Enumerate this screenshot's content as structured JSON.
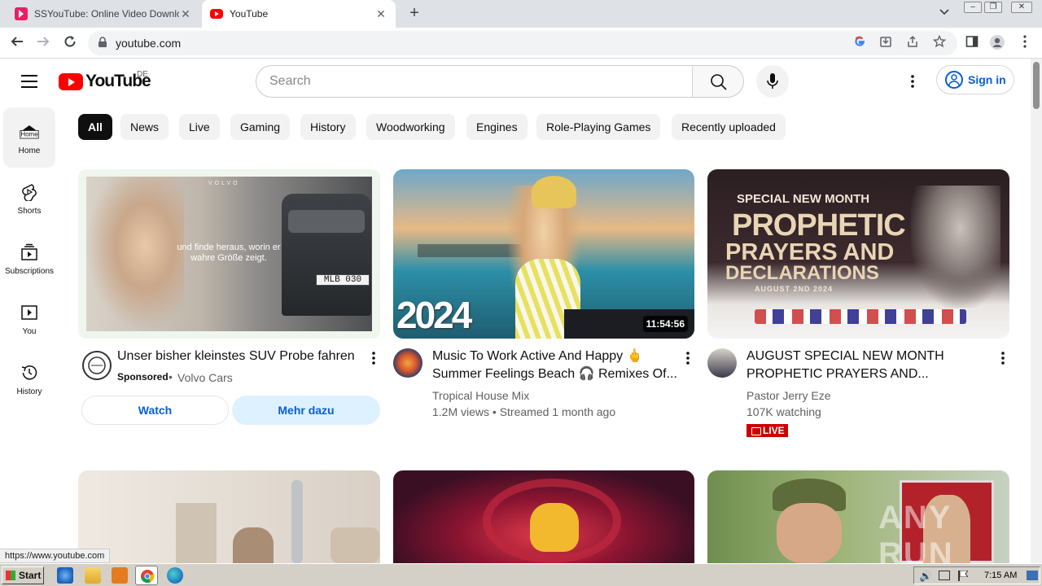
{
  "browser": {
    "tabs": [
      {
        "title": "SSYouTube: Online Video Downloader",
        "active": false
      },
      {
        "title": "YouTube",
        "active": true
      }
    ],
    "url": "youtube.com",
    "status_url": "https://www.youtube.com"
  },
  "masthead": {
    "logo_text": "YouTube",
    "country_code": "DE",
    "search_placeholder": "Search",
    "signin_label": "Sign in"
  },
  "sidebar": {
    "items": [
      {
        "label": "Home",
        "icon": "home-icon",
        "active": true
      },
      {
        "label": "Shorts",
        "icon": "shorts-icon"
      },
      {
        "label": "Subscriptions",
        "icon": "subscriptions-icon"
      },
      {
        "label": "You",
        "icon": "you-icon"
      },
      {
        "label": "History",
        "icon": "history-icon"
      }
    ]
  },
  "chips": [
    "All",
    "News",
    "Live",
    "Gaming",
    "History",
    "Woodworking",
    "Engines",
    "Role-Playing Games",
    "Recently uploaded"
  ],
  "videos": [
    {
      "title": "Unser bisher kleinstes SUV Probe fahren",
      "sponsored_label": "Sponsored",
      "channel": "Volvo Cars",
      "ad_overlay_text": "und finde heraus, worin er wahre Größe zeigt.",
      "plate": "MLB 030",
      "brand_mark": "VOLVO",
      "watch_label": "Watch",
      "more_label": "Mehr dazu"
    },
    {
      "title_line1": "Music To Work Active And Happy 🖕",
      "title_line2": "Summer Feelings Beach 🎧 Remixes Of...",
      "channel": "Tropical House Mix",
      "stats": "1.2M views • Streamed 1 month ago",
      "duration": "11:54:56",
      "thumb_text": "2024"
    },
    {
      "title_line1": "AUGUST SPECIAL NEW MONTH",
      "title_line2": "PROPHETIC PRAYERS AND...",
      "channel": "Pastor Jerry Eze",
      "stats": "107K watching",
      "live_label": "LIVE",
      "thumb_text_1": "SPECIAL NEW MONTH",
      "thumb_text_2": "PROPHETIC",
      "thumb_text_3": "PRAYERS AND",
      "thumb_text_4": "DECLARATIONS",
      "thumb_text_5": "AUGUST 2ND 2024"
    }
  ],
  "watermark": "ANY RUN",
  "taskbar": {
    "start_label": "Start",
    "clock": "7:15 AM"
  }
}
